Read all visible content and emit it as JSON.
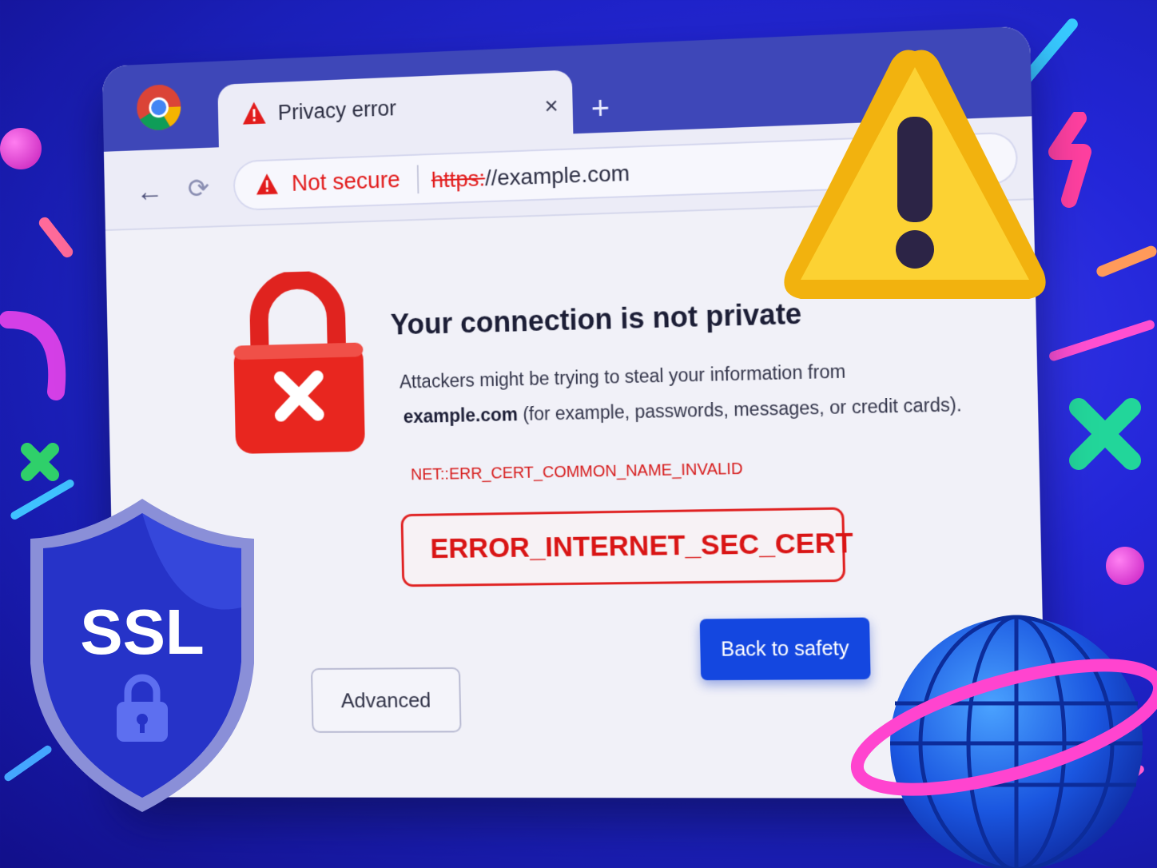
{
  "browser": {
    "tab": {
      "title": "Privacy error",
      "close": "×"
    },
    "new_tab": "+",
    "nav": {
      "back": "←",
      "reload": "⟳"
    },
    "omnibox": {
      "security_label": "Not secure",
      "url_scheme": "https:",
      "url_rest": "//example.com"
    }
  },
  "page": {
    "headline": "Your connection is not private",
    "body_line1": "Attackers might be trying to steal your information from",
    "body_domain": "example.com",
    "body_line2": " (for example, passwords, messages, or credit cards).",
    "error_code": "NET::ERR_CERT_COMMON_NAME_INVALID",
    "error_banner": "ERROR_INTERNET_SEC_CERT",
    "advanced_button": "Advanced",
    "back_button": "Back to safety"
  },
  "decor": {
    "shield_text": "SSL",
    "colors": {
      "accent_red": "#e21c1c",
      "primary_blue": "#1447e0",
      "warning_yellow": "#f7c21e",
      "background_blue": "#2326d8"
    }
  }
}
